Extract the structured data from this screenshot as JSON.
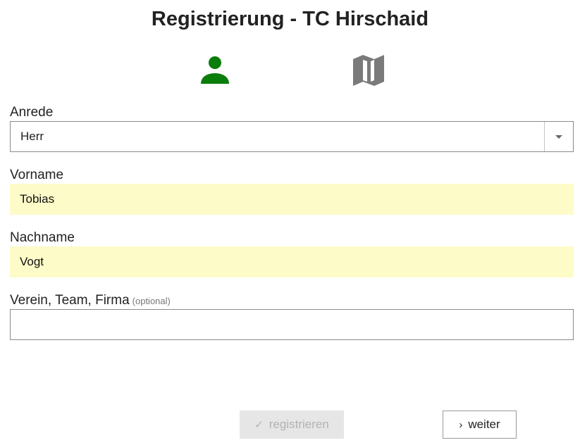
{
  "page": {
    "title": "Registrierung - TC Hirschaid"
  },
  "steps": [
    {
      "icon": "person-icon",
      "state": "active",
      "color": "#0b7d0b"
    },
    {
      "icon": "map-icon",
      "state": "inactive",
      "color": "#7a7a7a"
    }
  ],
  "form": {
    "salutation": {
      "label": "Anrede",
      "value": "Herr"
    },
    "first_name": {
      "label": "Vorname",
      "value": "Tobias"
    },
    "last_name": {
      "label": "Nachname",
      "value": "Vogt"
    },
    "club": {
      "label": "Verein, Team, Firma",
      "optional_hint": "(optional)",
      "value": ""
    }
  },
  "actions": {
    "register_label": "registrieren",
    "register_icon": "check-icon",
    "register_enabled": false,
    "next_label": "weiter",
    "next_icon": "chevron-right-icon"
  },
  "colors": {
    "accent_green": "#0b7d0b",
    "filled_field_bg": "#fdfbc8",
    "disabled_button_bg": "#e6e6e6"
  }
}
